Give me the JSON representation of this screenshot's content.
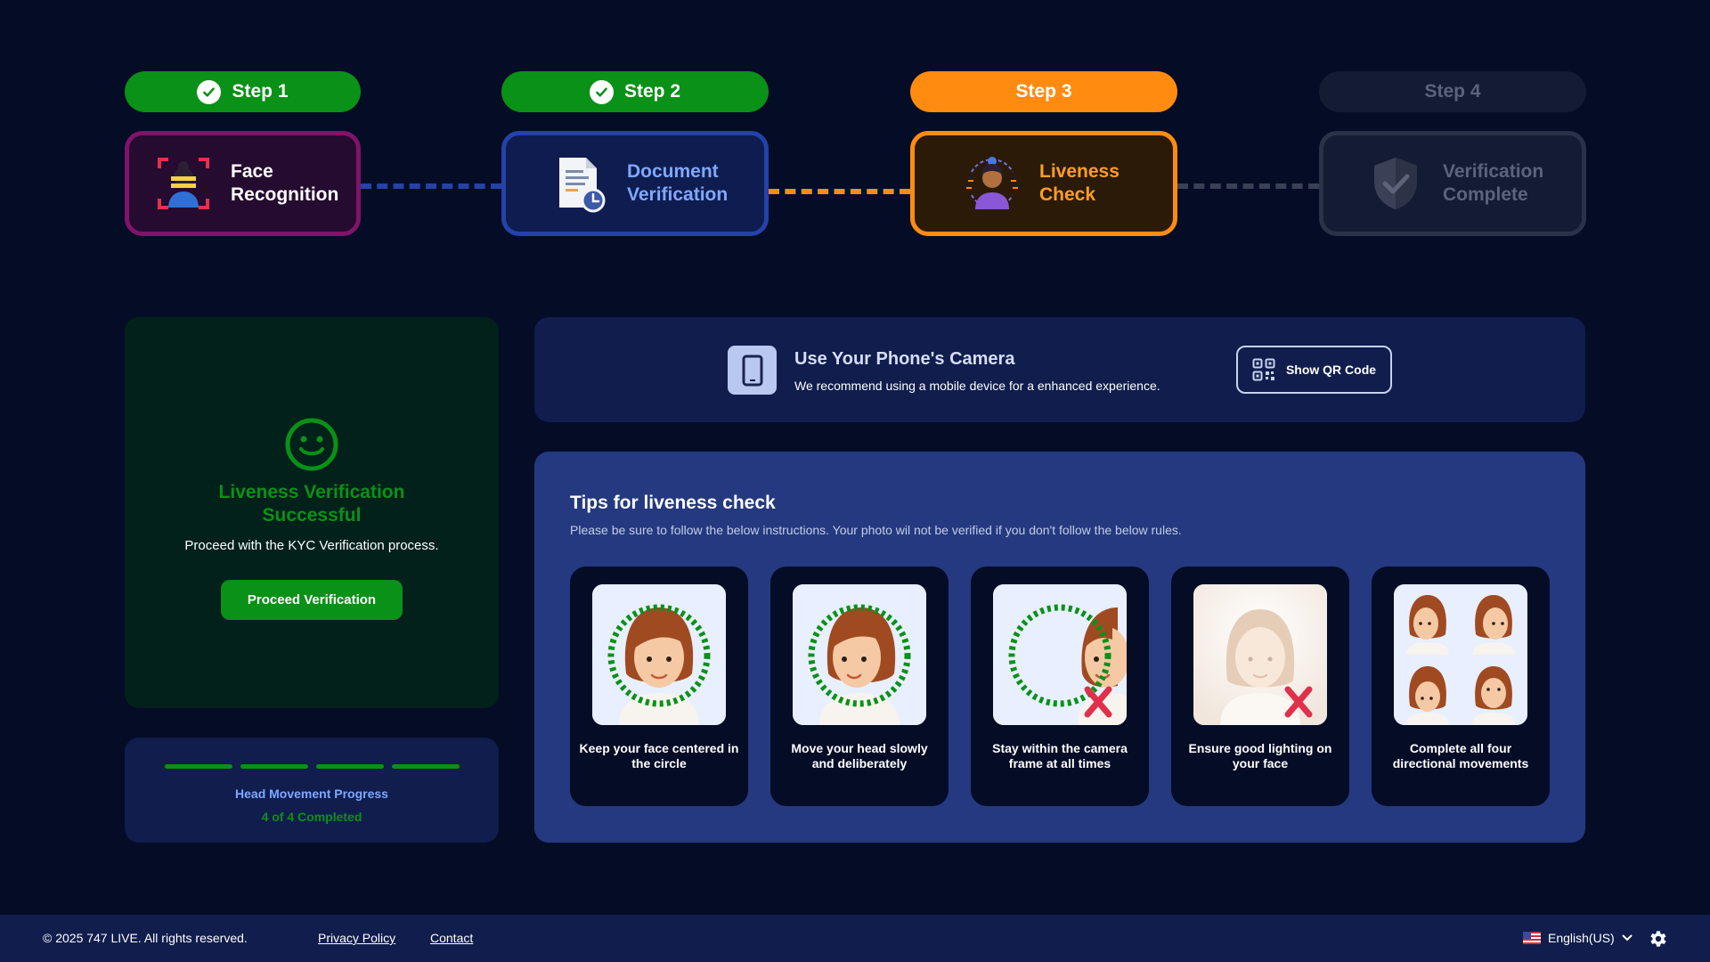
{
  "steps": [
    {
      "pill": "Step 1",
      "title": "Face\nRecognition",
      "status": "done"
    },
    {
      "pill": "Step 2",
      "title": "Document\nVerification",
      "status": "done"
    },
    {
      "pill": "Step 3",
      "title": "Liveness\nCheck",
      "status": "active"
    },
    {
      "pill": "Step 4",
      "title": "Verification\nComplete",
      "status": "pending"
    }
  ],
  "success": {
    "title": "Liveness Verification Successful",
    "subtitle": "Proceed with the KYC Verification process.",
    "button": "Proceed Verification"
  },
  "progress": {
    "title": "Head Movement Progress",
    "count": "4 of 4 Completed",
    "completed": 4,
    "total": 4
  },
  "phone": {
    "title": "Use Your Phone's Camera",
    "subtitle": "We recommend using a mobile device for a enhanced experience.",
    "button": "Show QR Code"
  },
  "tips": {
    "title": "Tips for liveness check",
    "subtitle": "Please be sure to follow the below instructions. Your photo wil not be verified if you don't follow the below rules.",
    "items": [
      {
        "label": "Keep your face centered in the circle",
        "icon": "face-centered-illustration",
        "valid": true
      },
      {
        "label": "Move your head slowly and deliberately",
        "icon": "head-movement-illustration",
        "valid": true
      },
      {
        "label": "Stay within the camera frame at all times",
        "icon": "out-of-frame-illustration",
        "valid": false
      },
      {
        "label": "Ensure good lighting on your face",
        "icon": "overexposed-face-illustration",
        "valid": false
      },
      {
        "label": "Complete all four directional movements",
        "icon": "four-directions-illustration",
        "valid": true
      }
    ]
  },
  "footer": {
    "copyright": "© 2025 747 LIVE. All rights reserved.",
    "privacy": "Privacy Policy",
    "contact": "Contact",
    "language": "English(US)"
  },
  "colors": {
    "success": "#0a9117",
    "active": "#ff8c10",
    "primary_blue": "#2442a8",
    "background": "#040c26"
  }
}
